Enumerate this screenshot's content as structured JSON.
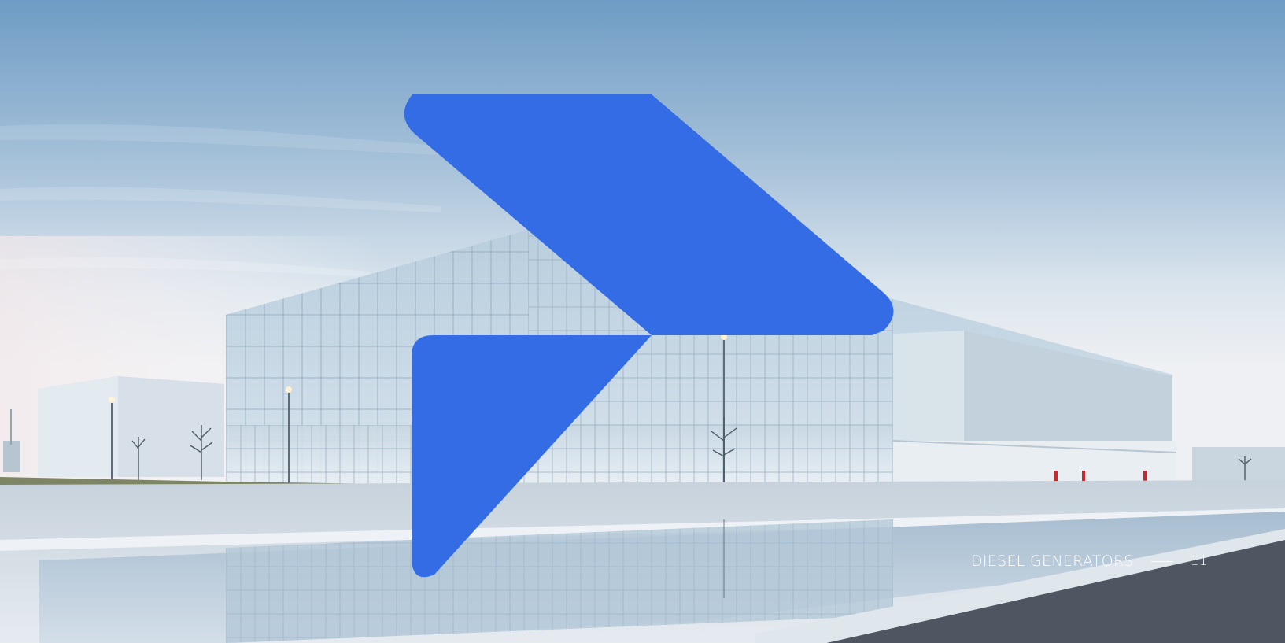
{
  "footer": {
    "title": "DIESEL GENERATORS",
    "page_number": "11"
  },
  "colors": {
    "logo_blue": "#336ce5",
    "sky_top": "#6e9cc4",
    "sky_bottom": "#dfe7ef"
  },
  "icons": {
    "logo": "brand-chevron-logo"
  }
}
